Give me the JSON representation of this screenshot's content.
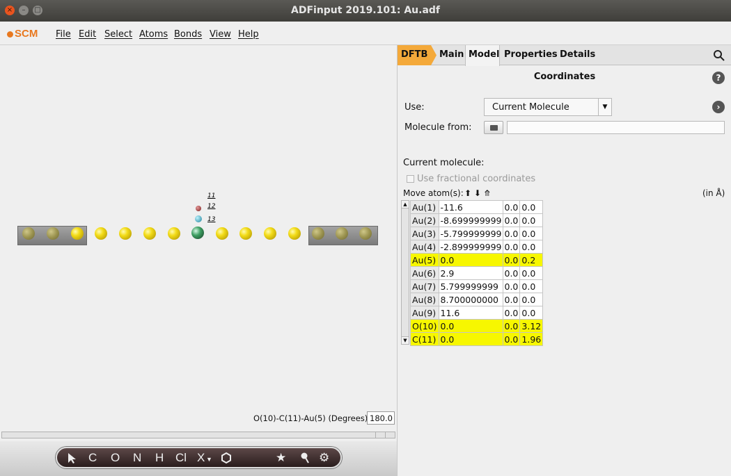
{
  "window": {
    "title": "ADFinput 2019.101: Au.adf"
  },
  "menu": {
    "logo": "SCM",
    "items": [
      "File",
      "Edit",
      "Select",
      "Atoms",
      "Bonds",
      "View",
      "Help"
    ]
  },
  "viewer": {
    "atom_labels": [
      "11",
      "12",
      "13"
    ],
    "angle_label": "O(10)-C(11)-Au(5) (Degrees):",
    "angle_value": "180.0"
  },
  "toolbar": {
    "tools": [
      "C",
      "O",
      "N",
      "H",
      "Cl",
      "X"
    ]
  },
  "panel": {
    "tabs": {
      "dftb": "DFTB",
      "main": "Main",
      "model": "Model",
      "properties": "Properties",
      "details": "Details"
    },
    "heading": "Coordinates",
    "use_label": "Use:",
    "use_value": "Current Molecule",
    "molecule_from_label": "Molecule from:",
    "current_molecule_label": "Current molecule:",
    "fractional_label": "Use fractional coordinates",
    "move_atoms_label": "Move atom(s):",
    "move_arrows": "⬆ ⬇ ⤊",
    "units_label": "(in Å)",
    "rows": [
      {
        "name": "Au(1)",
        "x": "-11.6",
        "y": "0.0",
        "z": "0.0",
        "hl": false
      },
      {
        "name": "Au(2)",
        "x": "-8.699999999",
        "y": "0.0",
        "z": "0.0",
        "hl": false
      },
      {
        "name": "Au(3)",
        "x": "-5.799999999",
        "y": "0.0",
        "z": "0.0",
        "hl": false
      },
      {
        "name": "Au(4)",
        "x": "-2.899999999",
        "y": "0.0",
        "z": "0.0",
        "hl": false
      },
      {
        "name": "Au(5)",
        "x": "0.0",
        "y": "0.0",
        "z": "0.2",
        "hl": true
      },
      {
        "name": "Au(6)",
        "x": "2.9",
        "y": "0.0",
        "z": "0.0",
        "hl": false
      },
      {
        "name": "Au(7)",
        "x": "5.799999999",
        "y": "0.0",
        "z": "0.0",
        "hl": false
      },
      {
        "name": "Au(8)",
        "x": "8.700000000",
        "y": "0.0",
        "z": "0.0",
        "hl": false
      },
      {
        "name": "Au(9)",
        "x": "11.6",
        "y": "0.0",
        "z": "0.0",
        "hl": false
      },
      {
        "name": "O(10)",
        "x": "0.0",
        "y": "0.0",
        "z": "3.12",
        "hl": true
      },
      {
        "name": "C(11)",
        "x": "0.0",
        "y": "0.0",
        "z": "1.96",
        "hl": true
      }
    ]
  }
}
